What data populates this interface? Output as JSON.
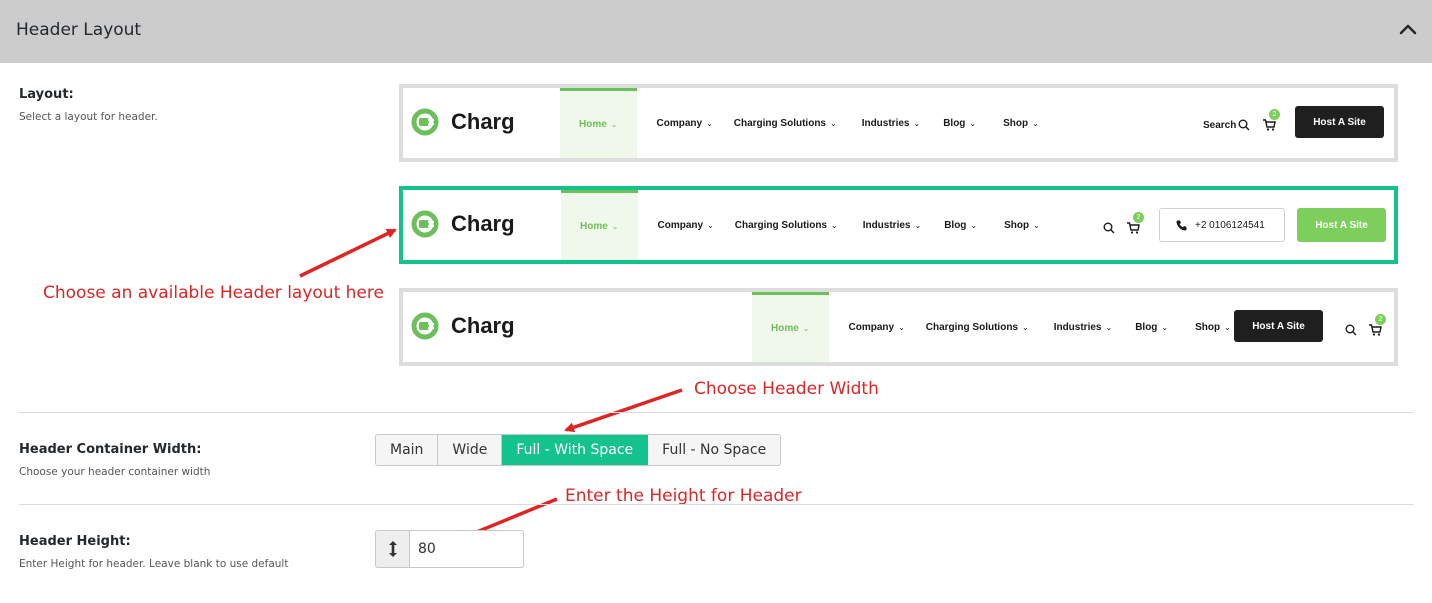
{
  "panel": {
    "title": "Header Layout",
    "collapse_icon": "chevron-up-icon"
  },
  "layout_field": {
    "label": "Layout:",
    "description": "Select a layout for header."
  },
  "layout_options": [
    {
      "logo_text": "Charg",
      "nav": [
        "Home",
        "Company",
        "Charging Solutions",
        "Industries",
        "Blog",
        "Shop"
      ],
      "search_label": "Search",
      "cart_count": "2",
      "button": "Host A Site"
    },
    {
      "logo_text": "Charg",
      "nav": [
        "Home",
        "Company",
        "Charging Solutions",
        "Industries",
        "Blog",
        "Shop"
      ],
      "cart_count": "2",
      "phone": "+2 0106124541",
      "button": "Host A Site"
    },
    {
      "logo_text": "Charg",
      "nav": [
        "Home",
        "Company",
        "Charging Solutions",
        "Industries",
        "Blog",
        "Shop"
      ],
      "cart_count": "2",
      "button": "Host A Site"
    }
  ],
  "annotations": {
    "layout": "Choose an available Header layout here",
    "width": "Choose Header Width",
    "height": "Enter the Height for Header"
  },
  "container_width": {
    "label": "Header Container Width:",
    "description": "Choose your header container width",
    "options": [
      "Main",
      "Wide",
      "Full - With Space",
      "Full - No Space"
    ],
    "selected": "Full - With Space"
  },
  "header_height": {
    "label": "Header Height:",
    "description": "Enter Height for header. Leave blank to use default",
    "value": "80",
    "addon_icon": "vertical-arrows-icon"
  },
  "colors": {
    "accent": "#14c28b",
    "brand_green": "#6cc05a",
    "annotation": "#e02424"
  }
}
